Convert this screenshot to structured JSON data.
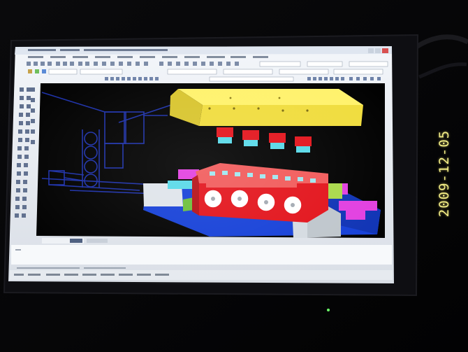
{
  "photo": {
    "date_stamp": "2009-12-05",
    "subject": "monitor-showing-autocad-3d-mold-model"
  },
  "monitor": {
    "app_title": "AutoCAD 2006",
    "colors": {
      "frame": "#0c0c10",
      "screen_chrome": "#e9edf2",
      "viewport": "#000000",
      "wireframe": "#1b2fa8",
      "plate": "#f2e24a",
      "red_block": "#e3131b",
      "cyan_face": "#57d9e8",
      "blue_base": "#1540d8",
      "magenta": "#e13fe0",
      "grey_face": "#bfc6cc",
      "date_stamp": "#f3ee86"
    }
  }
}
